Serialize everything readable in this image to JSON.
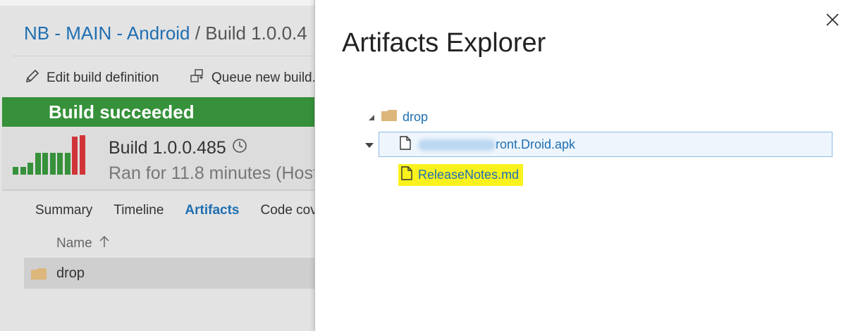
{
  "background_page": {
    "breadcrumb": {
      "project": "NB - MAIN - Android",
      "separator": " / ",
      "current": "Build 1.0.0.4"
    },
    "toolbar": {
      "edit_label": "Edit build definition",
      "queue_label": "Queue new build."
    },
    "status_banner": "Build succeeded",
    "build": {
      "number": "Build 1.0.0.485",
      "ran_for": "Ran for 11.8 minutes (Host"
    },
    "history_bars": [
      {
        "value": 0.2,
        "color": "#36913a"
      },
      {
        "value": 0.2,
        "color": "#36913a"
      },
      {
        "value": 0.3,
        "color": "#36913a"
      },
      {
        "value": 0.55,
        "color": "#36913a"
      },
      {
        "value": 0.55,
        "color": "#36913a"
      },
      {
        "value": 0.55,
        "color": "#36913a"
      },
      {
        "value": 0.55,
        "color": "#36913a"
      },
      {
        "value": 0.55,
        "color": "#36913a"
      },
      {
        "value": 0.97,
        "color": "#d13438"
      },
      {
        "value": 1.0,
        "color": "#d13438"
      }
    ],
    "tabs": [
      "Summary",
      "Timeline",
      "Artifacts",
      "Code cove"
    ],
    "active_tab": "Artifacts",
    "table": {
      "name_header": "Name",
      "rows": [
        "drop"
      ]
    }
  },
  "dialog": {
    "title": "Artifacts Explorer",
    "tree": {
      "root": "drop",
      "apk_visible_text": "ront.Droid.apk",
      "notes_file": "ReleaseNotes.md"
    }
  },
  "colors": {
    "link": "#1f6fb2",
    "success": "#36913a",
    "failure": "#d13438",
    "highlight": "#faf21d",
    "folder": "#dcb67a"
  }
}
